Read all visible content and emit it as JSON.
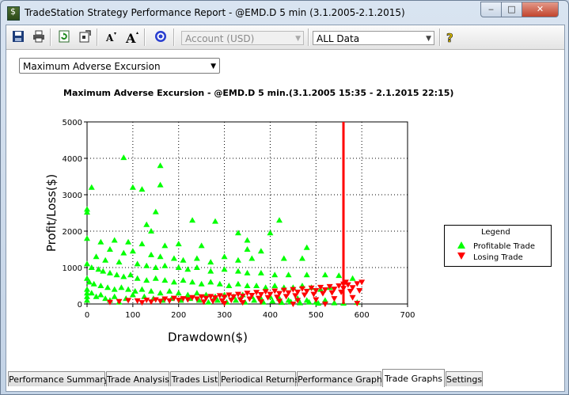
{
  "window": {
    "title": "TradeStation Strategy Performance Report - @EMD.D 5 min (3.1.2005-2.1.2015)"
  },
  "toolbar": {
    "account_combo": "Account (USD)",
    "data_combo": "ALL Data",
    "icons": [
      "save-icon",
      "print-icon",
      "refresh-icon",
      "settings-icon",
      "font-smaller-icon",
      "font-larger-icon",
      "target-icon",
      "help-icon"
    ]
  },
  "graph_select": "Maximum Adverse Excursion",
  "tabs": [
    "Performance Summary",
    "Trade Analysis",
    "Trades List",
    "Periodical Returns",
    "Performance Graphs",
    "Trade Graphs",
    "Settings"
  ],
  "active_tab": "Trade Graphs",
  "colors": {
    "profit": "#00ff00",
    "loss": "#ff0000",
    "marker_line": "#ff0000"
  },
  "chart_data": {
    "type": "scatter",
    "title": "Maximum Adverse Excursion - @EMD.D 5 min.(3.1.2005 15:35 - 2.1.2015 22:15)",
    "xlabel": "Drawdown($)",
    "ylabel": "Profit/Loss($)",
    "xlim": [
      0,
      700
    ],
    "ylim": [
      0,
      5000
    ],
    "x_ticks": [
      "0",
      "100",
      "200",
      "300",
      "400",
      "500",
      "600",
      "700"
    ],
    "y_ticks": [
      "0",
      "1000",
      "2000",
      "3000",
      "4000",
      "5000"
    ],
    "grid": true,
    "legend": {
      "title": "Legend",
      "placement": "right",
      "entries": [
        "Profitable Trade",
        "Losing Trade"
      ]
    },
    "vertical_marker_x": 560,
    "series": [
      {
        "name": "Profitable Trade",
        "marker": "triangle-up",
        "points": [
          [
            80,
            4020
          ],
          [
            160,
            3800
          ],
          [
            10,
            3200
          ],
          [
            100,
            3200
          ],
          [
            120,
            3150
          ],
          [
            160,
            3270
          ],
          [
            280,
            2270
          ],
          [
            0,
            2520
          ],
          [
            0,
            2600
          ],
          [
            150,
            2530
          ],
          [
            230,
            2300
          ],
          [
            420,
            2300
          ],
          [
            130,
            2180
          ],
          [
            140,
            2000
          ],
          [
            400,
            1950
          ],
          [
            330,
            1950
          ],
          [
            350,
            1750
          ],
          [
            0,
            1800
          ],
          [
            30,
            1700
          ],
          [
            60,
            1750
          ],
          [
            90,
            1700
          ],
          [
            120,
            1650
          ],
          [
            170,
            1600
          ],
          [
            200,
            1650
          ],
          [
            250,
            1600
          ],
          [
            350,
            1500
          ],
          [
            380,
            1450
          ],
          [
            480,
            1550
          ],
          [
            50,
            1500
          ],
          [
            80,
            1400
          ],
          [
            100,
            1450
          ],
          [
            140,
            1350
          ],
          [
            160,
            1300
          ],
          [
            190,
            1250
          ],
          [
            210,
            1200
          ],
          [
            240,
            1250
          ],
          [
            270,
            1150
          ],
          [
            300,
            1300
          ],
          [
            330,
            1200
          ],
          [
            360,
            1250
          ],
          [
            430,
            1250
          ],
          [
            470,
            1250
          ],
          [
            20,
            1300
          ],
          [
            40,
            1200
          ],
          [
            70,
            1150
          ],
          [
            110,
            1100
          ],
          [
            130,
            1050
          ],
          [
            150,
            1000
          ],
          [
            170,
            1050
          ],
          [
            200,
            1000
          ],
          [
            220,
            950
          ],
          [
            240,
            1000
          ],
          [
            270,
            900
          ],
          [
            300,
            950
          ],
          [
            330,
            900
          ],
          [
            350,
            850
          ],
          [
            380,
            850
          ],
          [
            410,
            800
          ],
          [
            440,
            800
          ],
          [
            480,
            800
          ],
          [
            520,
            800
          ],
          [
            550,
            780
          ],
          [
            580,
            700
          ],
          [
            0,
            1100
          ],
          [
            10,
            1000
          ],
          [
            25,
            950
          ],
          [
            35,
            900
          ],
          [
            50,
            850
          ],
          [
            65,
            800
          ],
          [
            80,
            750
          ],
          [
            95,
            800
          ],
          [
            110,
            700
          ],
          [
            130,
            650
          ],
          [
            150,
            700
          ],
          [
            170,
            650
          ],
          [
            190,
            600
          ],
          [
            210,
            650
          ],
          [
            230,
            600
          ],
          [
            250,
            550
          ],
          [
            270,
            600
          ],
          [
            290,
            550
          ],
          [
            310,
            500
          ],
          [
            330,
            550
          ],
          [
            350,
            500
          ],
          [
            370,
            500
          ],
          [
            390,
            450
          ],
          [
            410,
            500
          ],
          [
            430,
            450
          ],
          [
            450,
            450
          ],
          [
            470,
            500
          ],
          [
            490,
            450
          ],
          [
            510,
            400
          ],
          [
            530,
            450
          ],
          [
            0,
            700
          ],
          [
            5,
            600
          ],
          [
            15,
            550
          ],
          [
            30,
            500
          ],
          [
            45,
            450
          ],
          [
            60,
            400
          ],
          [
            75,
            450
          ],
          [
            90,
            400
          ],
          [
            105,
            350
          ],
          [
            120,
            400
          ],
          [
            140,
            350
          ],
          [
            160,
            300
          ],
          [
            180,
            350
          ],
          [
            200,
            300
          ],
          [
            220,
            250
          ],
          [
            240,
            300
          ],
          [
            260,
            250
          ],
          [
            280,
            200
          ],
          [
            300,
            250
          ],
          [
            320,
            200
          ],
          [
            340,
            250
          ],
          [
            360,
            200
          ],
          [
            380,
            150
          ],
          [
            400,
            200
          ],
          [
            420,
            150
          ],
          [
            440,
            100
          ],
          [
            460,
            150
          ],
          [
            480,
            100
          ],
          [
            500,
            50
          ],
          [
            520,
            100
          ],
          [
            0,
            400
          ],
          [
            0,
            300
          ],
          [
            0,
            200
          ],
          [
            0,
            100
          ],
          [
            10,
            300
          ],
          [
            20,
            200
          ],
          [
            30,
            250
          ],
          [
            40,
            150
          ],
          [
            50,
            100
          ],
          [
            60,
            200
          ],
          [
            70,
            50
          ],
          [
            85,
            150
          ],
          [
            100,
            250
          ],
          [
            125,
            200
          ],
          [
            145,
            150
          ],
          [
            165,
            100
          ],
          [
            185,
            150
          ],
          [
            205,
            100
          ],
          [
            225,
            150
          ],
          [
            245,
            100
          ],
          [
            265,
            50
          ],
          [
            285,
            100
          ],
          [
            305,
            50
          ],
          [
            325,
            100
          ],
          [
            345,
            50
          ],
          [
            365,
            100
          ],
          [
            385,
            50
          ],
          [
            405,
            80
          ],
          [
            425,
            40
          ],
          [
            445,
            60
          ],
          [
            465,
            30
          ],
          [
            485,
            50
          ],
          [
            505,
            20
          ],
          [
            540,
            30
          ],
          [
            560,
            20
          ],
          [
            590,
            40
          ]
        ]
      },
      {
        "name": "Losing Trade",
        "marker": "triangle-down",
        "points": [
          [
            50,
            50
          ],
          [
            70,
            70
          ],
          [
            90,
            100
          ],
          [
            110,
            90
          ],
          [
            130,
            110
          ],
          [
            150,
            120
          ],
          [
            170,
            140
          ],
          [
            190,
            160
          ],
          [
            210,
            150
          ],
          [
            230,
            180
          ],
          [
            250,
            200
          ],
          [
            270,
            210
          ],
          [
            290,
            230
          ],
          [
            310,
            250
          ],
          [
            330,
            270
          ],
          [
            350,
            300
          ],
          [
            370,
            320
          ],
          [
            390,
            340
          ],
          [
            410,
            360
          ],
          [
            430,
            380
          ],
          [
            450,
            400
          ],
          [
            470,
            420
          ],
          [
            490,
            440
          ],
          [
            510,
            460
          ],
          [
            530,
            480
          ],
          [
            550,
            500
          ],
          [
            570,
            530
          ],
          [
            590,
            560
          ],
          [
            600,
            600
          ],
          [
            120,
            40
          ],
          [
            140,
            60
          ],
          [
            160,
            80
          ],
          [
            180,
            90
          ],
          [
            200,
            110
          ],
          [
            220,
            120
          ],
          [
            240,
            140
          ],
          [
            260,
            160
          ],
          [
            280,
            170
          ],
          [
            300,
            190
          ],
          [
            320,
            200
          ],
          [
            340,
            220
          ],
          [
            360,
            240
          ],
          [
            380,
            260
          ],
          [
            400,
            270
          ],
          [
            420,
            290
          ],
          [
            440,
            310
          ],
          [
            460,
            330
          ],
          [
            480,
            350
          ],
          [
            500,
            370
          ],
          [
            520,
            390
          ],
          [
            540,
            410
          ],
          [
            560,
            430
          ],
          [
            580,
            450
          ],
          [
            255,
            60
          ],
          [
            275,
            80
          ],
          [
            295,
            90
          ],
          [
            315,
            110
          ],
          [
            335,
            120
          ],
          [
            355,
            140
          ],
          [
            375,
            160
          ],
          [
            395,
            180
          ],
          [
            415,
            190
          ],
          [
            435,
            210
          ],
          [
            455,
            230
          ],
          [
            475,
            250
          ],
          [
            495,
            270
          ],
          [
            515,
            290
          ],
          [
            535,
            310
          ],
          [
            555,
            330
          ],
          [
            575,
            350
          ],
          [
            595,
            370
          ],
          [
            300,
            20
          ],
          [
            340,
            40
          ],
          [
            380,
            60
          ],
          [
            420,
            80
          ],
          [
            460,
            100
          ],
          [
            500,
            120
          ],
          [
            540,
            150
          ],
          [
            580,
            180
          ],
          [
            560,
            550
          ],
          [
            565,
            600
          ],
          [
            450,
            0
          ],
          [
            520,
            0
          ],
          [
            590,
            20
          ]
        ]
      }
    ]
  }
}
